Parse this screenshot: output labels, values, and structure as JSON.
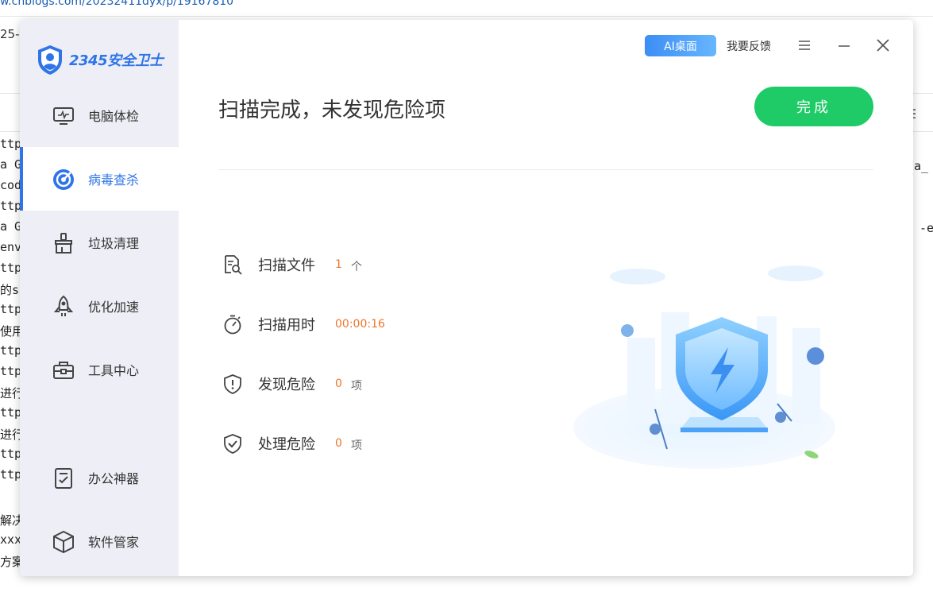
{
  "background": {
    "url": "w.cnblogs.com/20232411dyx/p/19167810",
    "date_fragment": "25-",
    "left_lines": [
      "ttp",
      "a G",
      "cod",
      "ttp",
      "a G",
      "env",
      "ttp",
      "的s",
      "ttp",
      "使用c",
      "ttp",
      "ttp",
      "进行u",
      "ttp",
      "进行s",
      "ttp",
      "ttp",
      "",
      "解决",
      "xxx",
      "方案"
    ],
    "right_lines": [
      "ga_",
      "-e"
    ],
    "menu_glyph": "☰"
  },
  "app": {
    "logo_text": "2345安全卫士",
    "sidebar": {
      "items": [
        {
          "label": "电脑体检",
          "icon": "monitor-icon",
          "active": false
        },
        {
          "label": "病毒查杀",
          "icon": "target-icon",
          "active": true
        },
        {
          "label": "垃圾清理",
          "icon": "broom-icon",
          "active": false
        },
        {
          "label": "优化加速",
          "icon": "rocket-icon",
          "active": false
        },
        {
          "label": "工具中心",
          "icon": "toolbox-icon",
          "active": false
        },
        {
          "label": "办公神器",
          "icon": "checklist-icon",
          "active": false
        },
        {
          "label": "软件管家",
          "icon": "box-icon",
          "active": false
        }
      ]
    },
    "header": {
      "ai_button": "AI桌面",
      "feedback": "我要反馈",
      "menu_icon": "hamburger-icon",
      "minimize_icon": "minimize-icon",
      "close_icon": "close-icon"
    },
    "result": {
      "title": "扫描完成，未发现危险项",
      "done_button": "完成",
      "stats": [
        {
          "label": "扫描文件",
          "value": "1",
          "unit": "个",
          "icon": "file-search-icon"
        },
        {
          "label": "扫描用时",
          "value": "00:00:16",
          "unit": "",
          "icon": "stopwatch-icon"
        },
        {
          "label": "发现危险",
          "value": "0",
          "unit": "项",
          "icon": "shield-alert-icon"
        },
        {
          "label": "处理危险",
          "value": "0",
          "unit": "项",
          "icon": "shield-check-icon"
        }
      ]
    },
    "colors": {
      "accent": "#2f74e8",
      "success": "#1ecb66",
      "value": "#f0752a",
      "sidebar_bg": "#eeeff6"
    }
  }
}
